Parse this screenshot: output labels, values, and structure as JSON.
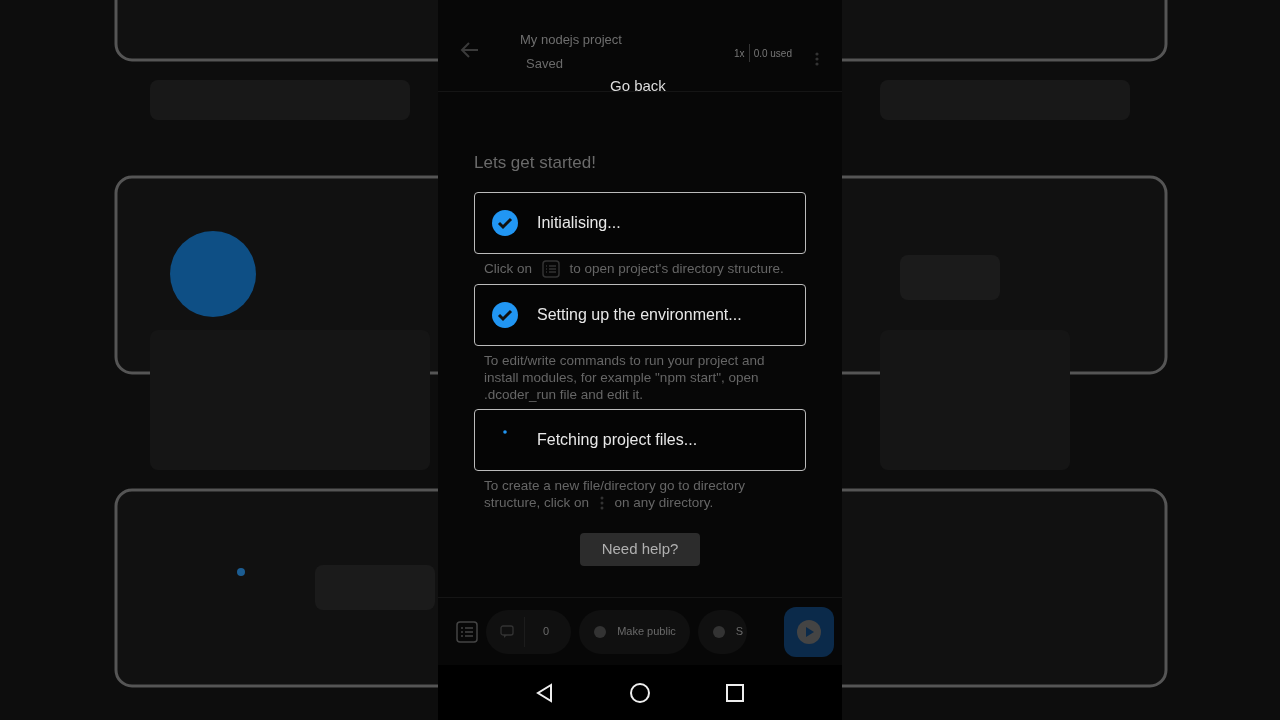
{
  "app_bar": {
    "title": "My nodejs project",
    "subtitle": "Saved",
    "speed": "1x",
    "usage": "0.0 used"
  },
  "tooltip": "Go back",
  "intro": {
    "title": "Lets get started!",
    "tips": [
      {
        "kind": "icon_tip",
        "before": "Click on",
        "after": "to open project's directory structure."
      },
      {
        "kind": "text",
        "text": "To edit/write commands to run your project and install modules, for example \"npm start\", open .dcoder_run file and edit it."
      },
      {
        "kind": "kebab_tip",
        "before": "To create a new file/directory go to directory structure, click on",
        "after": "on any directory."
      }
    ]
  },
  "steps": [
    {
      "label": "Initialising...",
      "done": true
    },
    {
      "label": "Setting up the environment...",
      "done": true
    },
    {
      "label": "Fetching project files...",
      "done": false
    }
  ],
  "help_button": "Need help?",
  "bottom_bar": {
    "comments": "0",
    "public_label": "Make public",
    "share_label": "S"
  }
}
